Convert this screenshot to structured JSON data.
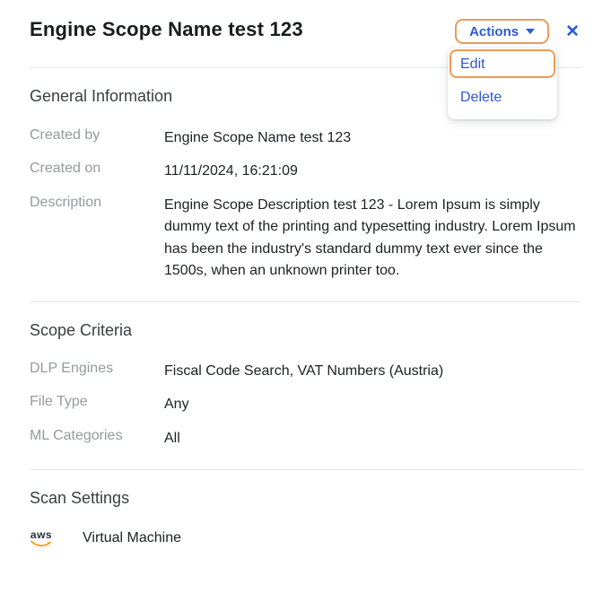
{
  "header": {
    "title": "Engine Scope Name test 123",
    "actions_label": "Actions",
    "icons": {
      "close": "✕"
    },
    "menu": [
      {
        "label": "Edit"
      },
      {
        "label": "Delete"
      }
    ]
  },
  "colors": {
    "accent_blue": "#2B59D8",
    "focus_ring_orange": "#ED9A55",
    "aws_orange": "#FF9900",
    "label_gray": "#97999E",
    "divider_gray": "#E3E6EA"
  },
  "sections": {
    "general": {
      "heading": "General Information",
      "rows": [
        {
          "label": "Created by",
          "value": "Engine Scope Name test 123"
        },
        {
          "label": "Created on",
          "value": "11/11/2024, 16:21:09"
        },
        {
          "label": "Description",
          "value": "Engine Scope Description test 123 - Lorem Ipsum is simply dummy text of the printing and typesetting industry. Lorem Ipsum has been the industry's standard dummy text ever since the 1500s, when an unknown printer too."
        }
      ]
    },
    "scope": {
      "heading": "Scope Criteria",
      "rows": [
        {
          "label": "DLP Engines",
          "value": "Fiscal Code Search, VAT Numbers (Austria)"
        },
        {
          "label": "File Type",
          "value": "Any"
        },
        {
          "label": "ML Categories",
          "value": "All"
        }
      ]
    },
    "scan": {
      "heading": "Scan Settings",
      "provider_label": "aws",
      "provider_value": "Virtual Machine"
    }
  }
}
